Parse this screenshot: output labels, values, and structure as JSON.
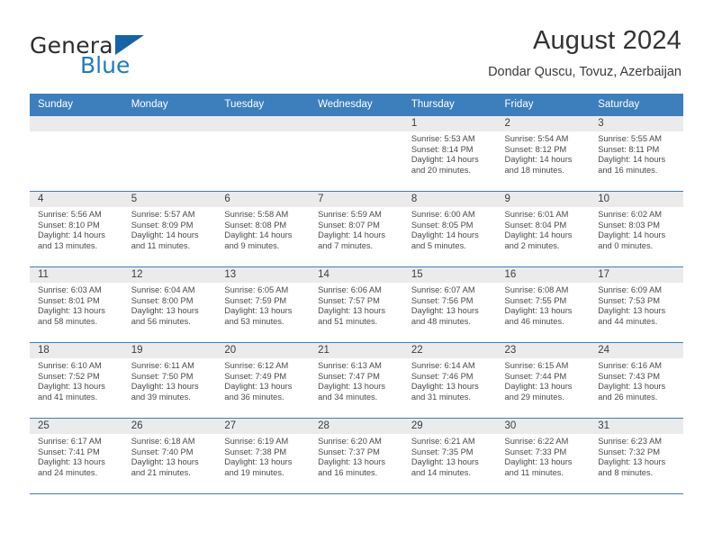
{
  "brand": {
    "name_part1": "General",
    "name_part2": "Blue",
    "accent_color": "#1f7ac1",
    "logo_triangle_color": "#1564a8"
  },
  "header": {
    "title": "August 2024",
    "subtitle": "Dondar Quscu, Tovuz, Azerbaijan"
  },
  "calendar": {
    "header_bg": "#3d7ebd",
    "daynum_bg": "#ebebeb",
    "weekday_headers": [
      "Sunday",
      "Monday",
      "Tuesday",
      "Wednesday",
      "Thursday",
      "Friday",
      "Saturday"
    ],
    "weeks": [
      [
        {
          "day": "",
          "empty": true
        },
        {
          "day": "",
          "empty": true
        },
        {
          "day": "",
          "empty": true
        },
        {
          "day": "",
          "empty": true
        },
        {
          "day": "1",
          "sunrise": "Sunrise: 5:53 AM",
          "sunset": "Sunset: 8:14 PM",
          "daylight": "Daylight: 14 hours and 20 minutes."
        },
        {
          "day": "2",
          "sunrise": "Sunrise: 5:54 AM",
          "sunset": "Sunset: 8:12 PM",
          "daylight": "Daylight: 14 hours and 18 minutes."
        },
        {
          "day": "3",
          "sunrise": "Sunrise: 5:55 AM",
          "sunset": "Sunset: 8:11 PM",
          "daylight": "Daylight: 14 hours and 16 minutes."
        }
      ],
      [
        {
          "day": "4",
          "sunrise": "Sunrise: 5:56 AM",
          "sunset": "Sunset: 8:10 PM",
          "daylight": "Daylight: 14 hours and 13 minutes."
        },
        {
          "day": "5",
          "sunrise": "Sunrise: 5:57 AM",
          "sunset": "Sunset: 8:09 PM",
          "daylight": "Daylight: 14 hours and 11 minutes."
        },
        {
          "day": "6",
          "sunrise": "Sunrise: 5:58 AM",
          "sunset": "Sunset: 8:08 PM",
          "daylight": "Daylight: 14 hours and 9 minutes."
        },
        {
          "day": "7",
          "sunrise": "Sunrise: 5:59 AM",
          "sunset": "Sunset: 8:07 PM",
          "daylight": "Daylight: 14 hours and 7 minutes."
        },
        {
          "day": "8",
          "sunrise": "Sunrise: 6:00 AM",
          "sunset": "Sunset: 8:05 PM",
          "daylight": "Daylight: 14 hours and 5 minutes."
        },
        {
          "day": "9",
          "sunrise": "Sunrise: 6:01 AM",
          "sunset": "Sunset: 8:04 PM",
          "daylight": "Daylight: 14 hours and 2 minutes."
        },
        {
          "day": "10",
          "sunrise": "Sunrise: 6:02 AM",
          "sunset": "Sunset: 8:03 PM",
          "daylight": "Daylight: 14 hours and 0 minutes."
        }
      ],
      [
        {
          "day": "11",
          "sunrise": "Sunrise: 6:03 AM",
          "sunset": "Sunset: 8:01 PM",
          "daylight": "Daylight: 13 hours and 58 minutes."
        },
        {
          "day": "12",
          "sunrise": "Sunrise: 6:04 AM",
          "sunset": "Sunset: 8:00 PM",
          "daylight": "Daylight: 13 hours and 56 minutes."
        },
        {
          "day": "13",
          "sunrise": "Sunrise: 6:05 AM",
          "sunset": "Sunset: 7:59 PM",
          "daylight": "Daylight: 13 hours and 53 minutes."
        },
        {
          "day": "14",
          "sunrise": "Sunrise: 6:06 AM",
          "sunset": "Sunset: 7:57 PM",
          "daylight": "Daylight: 13 hours and 51 minutes."
        },
        {
          "day": "15",
          "sunrise": "Sunrise: 6:07 AM",
          "sunset": "Sunset: 7:56 PM",
          "daylight": "Daylight: 13 hours and 48 minutes."
        },
        {
          "day": "16",
          "sunrise": "Sunrise: 6:08 AM",
          "sunset": "Sunset: 7:55 PM",
          "daylight": "Daylight: 13 hours and 46 minutes."
        },
        {
          "day": "17",
          "sunrise": "Sunrise: 6:09 AM",
          "sunset": "Sunset: 7:53 PM",
          "daylight": "Daylight: 13 hours and 44 minutes."
        }
      ],
      [
        {
          "day": "18",
          "sunrise": "Sunrise: 6:10 AM",
          "sunset": "Sunset: 7:52 PM",
          "daylight": "Daylight: 13 hours and 41 minutes."
        },
        {
          "day": "19",
          "sunrise": "Sunrise: 6:11 AM",
          "sunset": "Sunset: 7:50 PM",
          "daylight": "Daylight: 13 hours and 39 minutes."
        },
        {
          "day": "20",
          "sunrise": "Sunrise: 6:12 AM",
          "sunset": "Sunset: 7:49 PM",
          "daylight": "Daylight: 13 hours and 36 minutes."
        },
        {
          "day": "21",
          "sunrise": "Sunrise: 6:13 AM",
          "sunset": "Sunset: 7:47 PM",
          "daylight": "Daylight: 13 hours and 34 minutes."
        },
        {
          "day": "22",
          "sunrise": "Sunrise: 6:14 AM",
          "sunset": "Sunset: 7:46 PM",
          "daylight": "Daylight: 13 hours and 31 minutes."
        },
        {
          "day": "23",
          "sunrise": "Sunrise: 6:15 AM",
          "sunset": "Sunset: 7:44 PM",
          "daylight": "Daylight: 13 hours and 29 minutes."
        },
        {
          "day": "24",
          "sunrise": "Sunrise: 6:16 AM",
          "sunset": "Sunset: 7:43 PM",
          "daylight": "Daylight: 13 hours and 26 minutes."
        }
      ],
      [
        {
          "day": "25",
          "sunrise": "Sunrise: 6:17 AM",
          "sunset": "Sunset: 7:41 PM",
          "daylight": "Daylight: 13 hours and 24 minutes."
        },
        {
          "day": "26",
          "sunrise": "Sunrise: 6:18 AM",
          "sunset": "Sunset: 7:40 PM",
          "daylight": "Daylight: 13 hours and 21 minutes."
        },
        {
          "day": "27",
          "sunrise": "Sunrise: 6:19 AM",
          "sunset": "Sunset: 7:38 PM",
          "daylight": "Daylight: 13 hours and 19 minutes."
        },
        {
          "day": "28",
          "sunrise": "Sunrise: 6:20 AM",
          "sunset": "Sunset: 7:37 PM",
          "daylight": "Daylight: 13 hours and 16 minutes."
        },
        {
          "day": "29",
          "sunrise": "Sunrise: 6:21 AM",
          "sunset": "Sunset: 7:35 PM",
          "daylight": "Daylight: 13 hours and 14 minutes."
        },
        {
          "day": "30",
          "sunrise": "Sunrise: 6:22 AM",
          "sunset": "Sunset: 7:33 PM",
          "daylight": "Daylight: 13 hours and 11 minutes."
        },
        {
          "day": "31",
          "sunrise": "Sunrise: 6:23 AM",
          "sunset": "Sunset: 7:32 PM",
          "daylight": "Daylight: 13 hours and 8 minutes."
        }
      ]
    ]
  }
}
